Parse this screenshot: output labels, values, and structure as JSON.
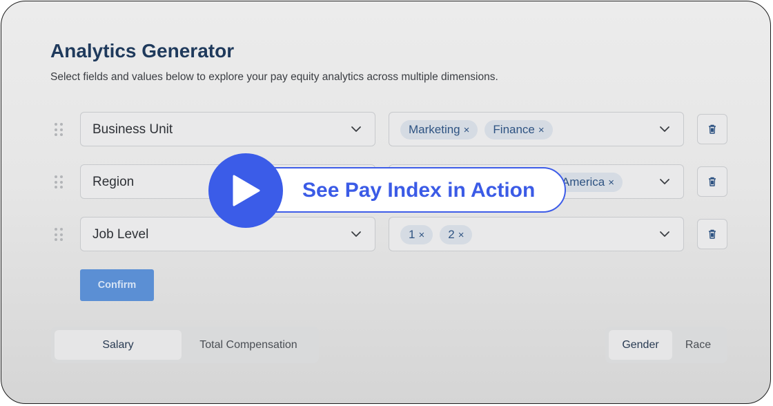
{
  "header": {
    "title": "Analytics Generator",
    "subtitle": "Select fields and values below to explore your pay equity analytics across multiple dimensions."
  },
  "rows": [
    {
      "field": "Business Unit",
      "values": [
        "Marketing",
        "Finance"
      ]
    },
    {
      "field": "Region",
      "values": [
        "America"
      ]
    },
    {
      "field": "Job Level",
      "values": [
        "1",
        "2"
      ]
    }
  ],
  "chip_remove_glyph": "×",
  "confirm_label": "Confirm",
  "compensation_toggle": {
    "options": [
      "Salary",
      "Total Compensation"
    ],
    "selected": "Salary"
  },
  "dimension_toggle": {
    "options": [
      "Gender",
      "Race"
    ],
    "selected": "Gender"
  },
  "overlay": {
    "cta_label": "See Pay Index in Action",
    "icon": "play-icon"
  },
  "colors": {
    "title": "#1f3a5c",
    "chip_text": "#2e5382",
    "confirm_bg": "#5b8fd4",
    "cta": "#3b5ce8"
  }
}
